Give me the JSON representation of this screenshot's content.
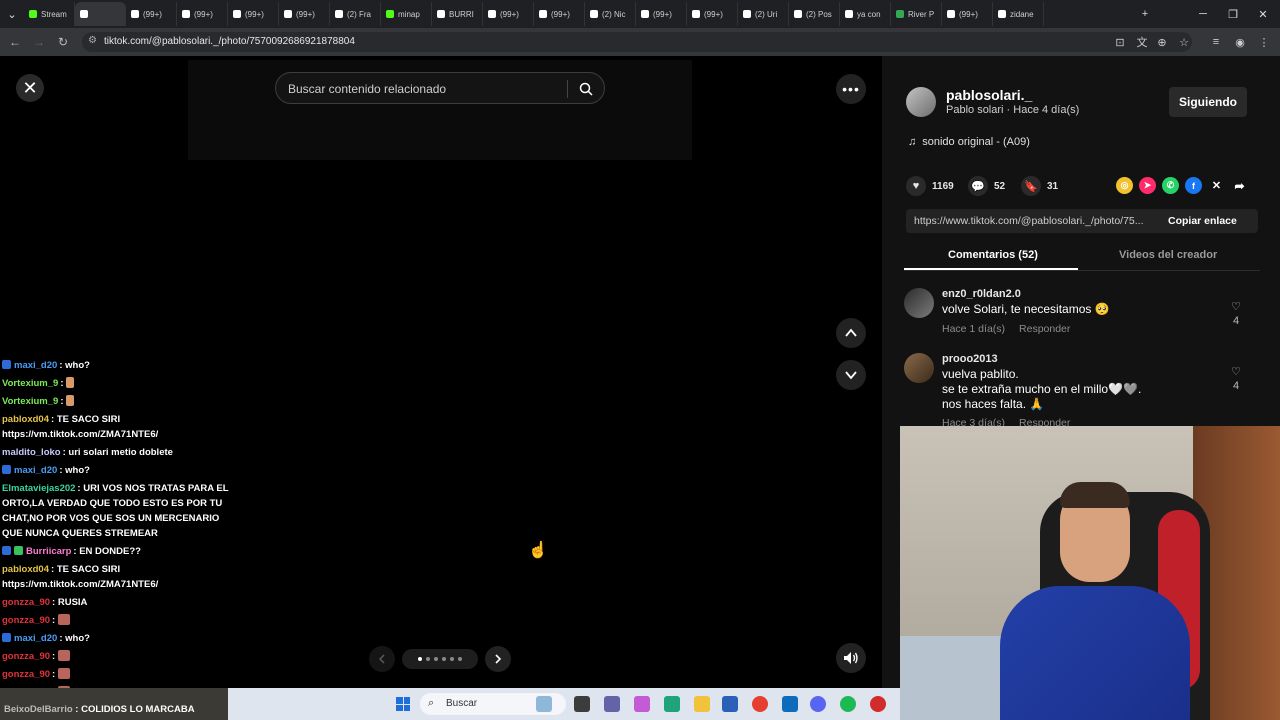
{
  "browser": {
    "tabs": [
      {
        "label": "Stream",
        "color": "#53fc18"
      },
      {
        "label": "",
        "color": "#ffffff"
      },
      {
        "label": "(99+)",
        "color": "#ffffff"
      },
      {
        "label": "(99+)",
        "color": "#ffffff"
      },
      {
        "label": "(99+)",
        "color": "#ffffff"
      },
      {
        "label": "(99+)",
        "color": "#ffffff"
      },
      {
        "label": "(2) Fra",
        "color": "#ffffff"
      },
      {
        "label": "minap",
        "color": "#53fc18"
      },
      {
        "label": "BURRI",
        "color": "#ffffff"
      },
      {
        "label": "(99+)",
        "color": "#ffffff"
      },
      {
        "label": "(99+)",
        "color": "#ffffff"
      },
      {
        "label": "(2) Nic",
        "color": "#ffffff"
      },
      {
        "label": "(99+)",
        "color": "#ffffff"
      },
      {
        "label": "(99+)",
        "color": "#ffffff"
      },
      {
        "label": "(2) Uri",
        "color": "#ffffff"
      },
      {
        "label": "(2) Pos",
        "color": "#ffffff"
      },
      {
        "label": "ya con",
        "color": "#ffffff"
      },
      {
        "label": "River P",
        "color": "#34a853"
      },
      {
        "label": "(99+)",
        "color": "#ffffff"
      },
      {
        "label": "zidane",
        "color": "#ffffff"
      }
    ],
    "url": "tiktok.com/@pablosolari._/photo/7570092686921878804"
  },
  "player": {
    "search_placeholder": "Buscar contenido relacionado",
    "page_count": 6,
    "current_page": 1
  },
  "chat": [
    {
      "badge": "blue",
      "user": "maxi_d20",
      "color": "#4a9df5",
      "text": "who?"
    },
    {
      "badge": "",
      "user": "Vortexium_9",
      "color": "#7bea5a",
      "text": "",
      "emote": "hand"
    },
    {
      "badge": "",
      "user": "Vortexium_9",
      "color": "#7bea5a",
      "text": "",
      "emote": "hand"
    },
    {
      "badge": "",
      "user": "pabloxd04",
      "color": "#e6c34a",
      "text": "TE SACO SIRI https://vm.tiktok.com/ZMA71NTE6/"
    },
    {
      "badge": "",
      "user": "maldito_loko",
      "color": "#c9c9ff",
      "text": "uri solari metio doblete"
    },
    {
      "badge": "blue",
      "user": "maxi_d20",
      "color": "#4a9df5",
      "text": "who?"
    },
    {
      "badge": "",
      "user": "Elmataviejas202",
      "color": "#38d6a0",
      "text": "URI VOS NOS TRATAS PARA EL ORTO,LA VERDAD QUE TODO ESTO ES POR TU CHAT,NO POR VOS QUE SOS UN MERCENARIO QUE NUNCA QUERES STREMEAR"
    },
    {
      "badge": "both",
      "user": "Burriicarp",
      "color": "#ff7ad1",
      "text": "EN DONDE??"
    },
    {
      "badge": "",
      "user": "pabloxd04",
      "color": "#e6c34a",
      "text": "TE SACO SIRI https://vm.tiktok.com/ZMA71NTE6/"
    },
    {
      "badge": "",
      "user": "gonzza_90",
      "color": "#e0323c",
      "text": "RUSIA"
    },
    {
      "badge": "",
      "user": "gonzza_90",
      "color": "#e0323c",
      "text": "",
      "emote": "face"
    },
    {
      "badge": "blue",
      "user": "maxi_d20",
      "color": "#4a9df5",
      "text": "who?"
    },
    {
      "badge": "",
      "user": "gonzza_90",
      "color": "#e0323c",
      "text": "",
      "emote": "face"
    },
    {
      "badge": "",
      "user": "gonzza_90",
      "color": "#e0323c",
      "text": "",
      "emote": "face"
    },
    {
      "badge": "",
      "user": "gonzza_90",
      "color": "#e0323c",
      "text": "",
      "emote": "face"
    }
  ],
  "bottom_strip": {
    "user": "BeixoDelBarrio",
    "text": "COLIDIOS LO MARCABA"
  },
  "panel": {
    "username": "pablosolari._",
    "subline": "Pablo solari · Hace 4 día(s)",
    "follow_label": "Siguiendo",
    "sound": "sonido original - (A09)",
    "likes": "1169",
    "comments": "52",
    "saves": "31",
    "link": "https://www.tiktok.com/@pablosolari._/photo/75...",
    "copy_label": "Copiar enlace",
    "tab_comments": "Comentarios (52)",
    "tab_videos": "Videos del creador",
    "reply_label": "Responder",
    "comment_list": [
      {
        "user": "enz0_r0ldan2.0",
        "text": "volve Solari, te necesitamos 🥺",
        "time": "Hace 1 día(s)",
        "likes": "4"
      },
      {
        "user": "prooo2013",
        "text": "vuelva pablito.\nse te extraña mucho en el millo🤍🩶.\nnos haces falta. 🙏",
        "time": "Hace 3 día(s)",
        "likes": "4"
      }
    ]
  },
  "taskbar": {
    "search_placeholder": "Buscar"
  }
}
